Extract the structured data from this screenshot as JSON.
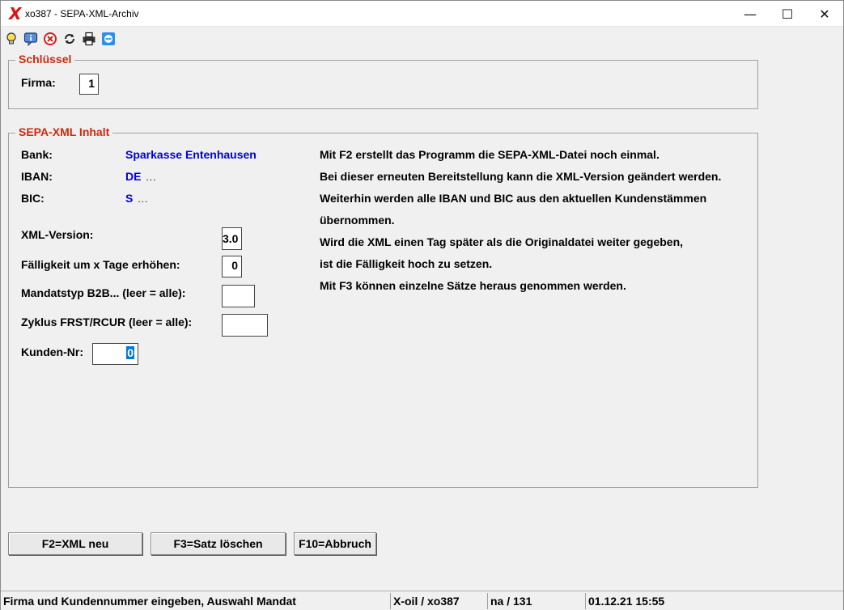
{
  "window": {
    "logo": "X",
    "title": "xo387 - SEPA-XML-Archiv",
    "minimize": "—",
    "maximize": "☐",
    "close": "✕"
  },
  "toolbar": {
    "icons": [
      "lightbulb-icon",
      "info-icon",
      "cancel-icon",
      "refresh-icon",
      "print-icon",
      "teamviewer-icon"
    ]
  },
  "schluessel": {
    "legend": "Schlüssel",
    "firma_label": "Firma:",
    "firma_value": "1"
  },
  "inhalt": {
    "legend": "SEPA-XML Inhalt",
    "bank_label": "Bank:",
    "bank_value": "Sparkasse Entenhausen",
    "iban_label": "IBAN:",
    "iban_value": "DE",
    "iban_masked": "...",
    "bic_label": "BIC:",
    "bic_value": "S",
    "bic_masked": "...",
    "xml_version_label": "XML-Version:",
    "xml_version_value": "3.0",
    "faelligkeit_label": "Fälligkeit um x Tage erhöhen:",
    "faelligkeit_value": "0",
    "mandatstyp_label": "Mandatstyp B2B... (leer = alle):",
    "mandatstyp_value": "",
    "zyklus_label": "Zyklus FRST/RCUR (leer = alle):",
    "zyklus_value": "",
    "kunden_label": "Kunden-Nr:",
    "kunden_value": "0",
    "info_lines": [
      "Mit F2 erstellt das Programm die SEPA-XML-Datei noch einmal.",
      "Bei dieser erneuten Bereitstellung kann die XML-Version geändert werden.",
      "Weiterhin werden alle IBAN und BIC aus den aktuellen Kundenstämmen",
      "übernommen.",
      "Wird die XML einen Tag später als die Originaldatei weiter gegeben,",
      "ist die Fälligkeit hoch zu setzen.",
      "Mit F3 können einzelne Sätze heraus genommen werden."
    ]
  },
  "buttons": {
    "f2": "F2=XML neu",
    "f3": "F3=Satz löschen",
    "f10": "F10=Abbruch"
  },
  "status": {
    "message": "Firma und Kundennummer eingeben, Auswahl Mandat",
    "program": "X-oil / xo387",
    "user": "na / 131",
    "datetime": "01.12.21 15:55"
  }
}
